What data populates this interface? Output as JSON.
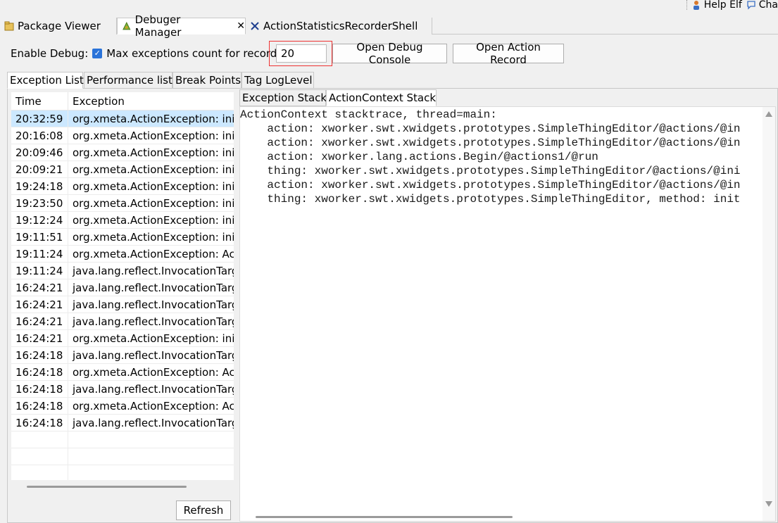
{
  "topbar": {
    "help_label": "Help Elf",
    "chat_label": "Cha"
  },
  "editor_tabs": [
    {
      "label": "Package Viewer",
      "icon": "package-icon"
    },
    {
      "label": "Debuger Manager",
      "icon": "debug-manager-icon",
      "active": true
    },
    {
      "label": "ActionStatisticsRecorderShell",
      "icon": "shell-icon"
    }
  ],
  "controls": {
    "enable_debug_label": "Enable Debug:",
    "enable_debug_checked": true,
    "max_exceptions_label": "Max exceptions count for record:",
    "max_exceptions_value": "20",
    "open_console_label": "Open Debug Console",
    "open_action_record_label": "Open Action Record"
  },
  "debug_tabs": [
    {
      "label": "Exception List",
      "active": true
    },
    {
      "label": "Performance list"
    },
    {
      "label": "Break Points"
    },
    {
      "label": "Tag LogLevel"
    }
  ],
  "exception_table": {
    "columns": [
      "Time",
      "Exception"
    ],
    "rows": [
      {
        "time": "20:32:59",
        "exception": "org.xmeta.ActionException: init",
        "selected": true
      },
      {
        "time": "20:16:08",
        "exception": "org.xmeta.ActionException: init"
      },
      {
        "time": "20:09:46",
        "exception": "org.xmeta.ActionException: init"
      },
      {
        "time": "20:09:21",
        "exception": "org.xmeta.ActionException: init"
      },
      {
        "time": "19:24:18",
        "exception": "org.xmeta.ActionException: init"
      },
      {
        "time": "19:23:50",
        "exception": "org.xmeta.ActionException: init"
      },
      {
        "time": "19:12:24",
        "exception": "org.xmeta.ActionException: init"
      },
      {
        "time": "19:11:51",
        "exception": "org.xmeta.ActionException: init"
      },
      {
        "time": "19:11:24",
        "exception": "org.xmeta.ActionException: Act"
      },
      {
        "time": "19:11:24",
        "exception": "java.lang.reflect.InvocationTarge"
      },
      {
        "time": "16:24:21",
        "exception": "java.lang.reflect.InvocationTarge"
      },
      {
        "time": "16:24:21",
        "exception": "java.lang.reflect.InvocationTarge"
      },
      {
        "time": "16:24:21",
        "exception": "java.lang.reflect.InvocationTarge"
      },
      {
        "time": "16:24:21",
        "exception": "org.xmeta.ActionException: init"
      },
      {
        "time": "16:24:18",
        "exception": "java.lang.reflect.InvocationTarge"
      },
      {
        "time": "16:24:18",
        "exception": "org.xmeta.ActionException: Act"
      },
      {
        "time": "16:24:18",
        "exception": "java.lang.reflect.InvocationTarge"
      },
      {
        "time": "16:24:18",
        "exception": "org.xmeta.ActionException: Act"
      },
      {
        "time": "16:24:18",
        "exception": "java.lang.reflect.InvocationTarge"
      },
      {
        "time": "",
        "exception": ""
      },
      {
        "time": "",
        "exception": ""
      },
      {
        "time": "",
        "exception": ""
      }
    ]
  },
  "refresh_label": "Refresh",
  "stack_tabs": [
    {
      "label": "Exception Stack"
    },
    {
      "label": "ActionContext Stack",
      "active": true
    }
  ],
  "stack_lines": [
    "ActionContext stacktrace, thread=main:",
    "    action: xworker.swt.xwidgets.prototypes.SimpleThingEditor/@actions/@in",
    "    action: xworker.swt.xwidgets.prototypes.SimpleThingEditor/@actions/@in",
    "    action: xworker.lang.actions.Begin/@actions1/@run",
    "    thing: xworker.swt.xwidgets.prototypes.SimpleThingEditor/@actions/@ini",
    "    action: xworker.swt.xwidgets.prototypes.SimpleThingEditor/@actions/@in",
    "    thing: xworker.swt.xwidgets.prototypes.SimpleThingEditor, method: init"
  ]
}
